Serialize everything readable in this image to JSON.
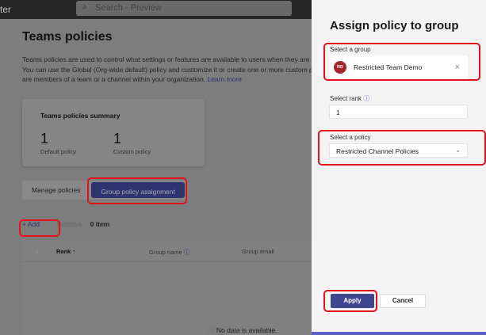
{
  "topbar": {
    "app_name": "ter",
    "search_placeholder": "Search - Preview"
  },
  "page": {
    "title": "Teams policies",
    "description": [
      "Teams policies are used to control what settings or features are available to users when they are using",
      "You can use the Global (Org-wide default) policy and customize it or create one or more custom polic",
      "are members of a team or a channel within your organization."
    ],
    "learn_more": "Learn more"
  },
  "summary": {
    "title": "Teams policies summary",
    "default_count": "1",
    "default_label": "Default policy",
    "custom_count": "1",
    "custom_label": "Custom policy"
  },
  "tabs": [
    {
      "label": "Manage policies"
    },
    {
      "label": "Group policy assignment"
    }
  ],
  "toolbar": {
    "add": "Add",
    "remove": "Remove",
    "count": "0 item"
  },
  "table": {
    "columns": [
      "Rank",
      "Group name",
      "Group email"
    ],
    "empty": "No data is available."
  },
  "panel": {
    "title": "Assign policy to group",
    "group_label": "Select a group",
    "group_initials": "RD",
    "group_name": "Restricted Team Demo",
    "rank_label": "Select rank",
    "rank_value": "1",
    "policy_label": "Select a policy",
    "policy_value": "Restricted Channel Policies",
    "apply": "Apply",
    "cancel": "Cancel"
  },
  "colors": {
    "accent": "#3f468f",
    "highlight": "#e0121b",
    "avatar": "#a4262c"
  }
}
